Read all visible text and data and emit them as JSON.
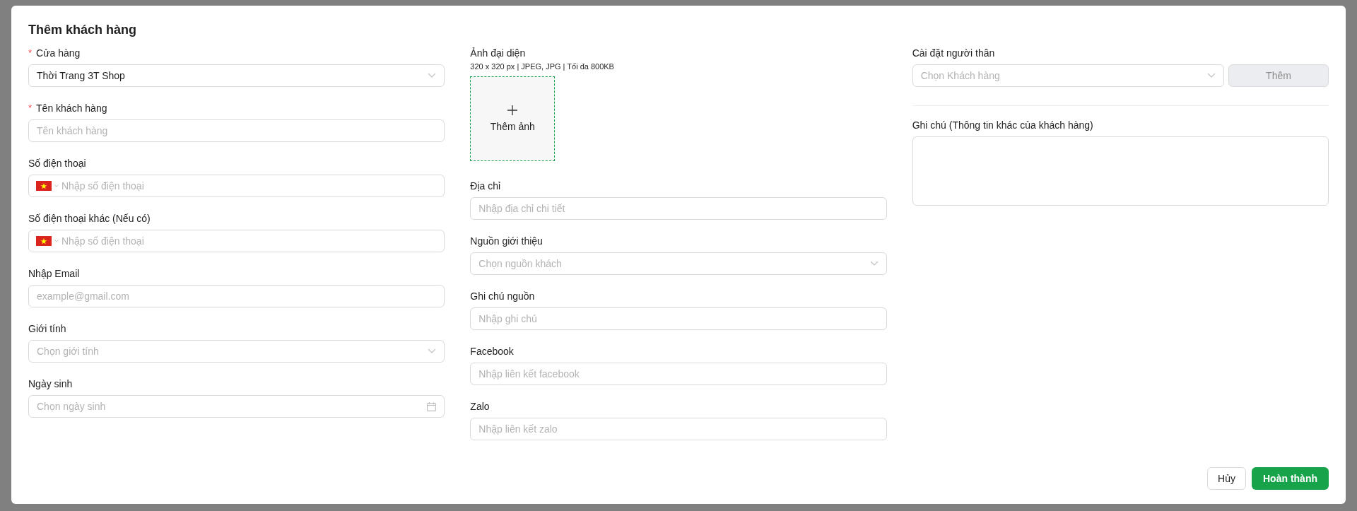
{
  "dialog": {
    "title": "Thêm khách hàng"
  },
  "column_1": [
    {
      "kind": "select",
      "label": "Cửa hàng",
      "required_mark": "*",
      "value": "Thời Trang 3T Shop"
    },
    {
      "kind": "text",
      "label": "Tên khách hàng",
      "required_mark": "*",
      "placeholder": "Tên khách hàng"
    },
    {
      "kind": "phone",
      "label": "Số điện thoại",
      "placeholder": "Nhập số điện thoại"
    },
    {
      "kind": "phone",
      "label": "Số điện thoại khác (Nếu có)",
      "placeholder": "Nhập số điện thoại"
    },
    {
      "kind": "text",
      "label": "Nhập Email",
      "placeholder": "example@gmail.com"
    },
    {
      "kind": "select",
      "label": "Giới tính",
      "placeholder": "Chọn giới tính"
    },
    {
      "kind": "date",
      "label": "Ngày sinh",
      "placeholder": "Chọn ngày sinh"
    }
  ],
  "avatar": {
    "label": "Ảnh đại diện",
    "hint": "320 x 320 px | JPEG, JPG | Tối đa 800KB",
    "button": "Thêm ảnh"
  },
  "column_2": [
    {
      "kind": "text",
      "label": "Địa chỉ",
      "placeholder": "Nhập địa chỉ chi tiết"
    },
    {
      "kind": "select",
      "label": "Nguồn giới thiệu",
      "placeholder": "Chọn nguồn khách"
    },
    {
      "kind": "text",
      "label": "Ghi chú nguồn",
      "placeholder": "Nhập ghi chú"
    },
    {
      "kind": "text",
      "label": "Facebook",
      "placeholder": "Nhập liên kết facebook"
    },
    {
      "kind": "text",
      "label": "Zalo",
      "placeholder": "Nhập liên kết zalo"
    }
  ],
  "relative": {
    "label": "Cài đặt người thân",
    "placeholder": "Chọn Khách hàng",
    "button": {
      "label": "Thêm",
      "disabled": true
    }
  },
  "note": {
    "label": "Ghi chú (Thông tin khác của khách hàng)"
  },
  "footer": {
    "cancel": "Hủy",
    "submit": "Hoàn thành"
  }
}
